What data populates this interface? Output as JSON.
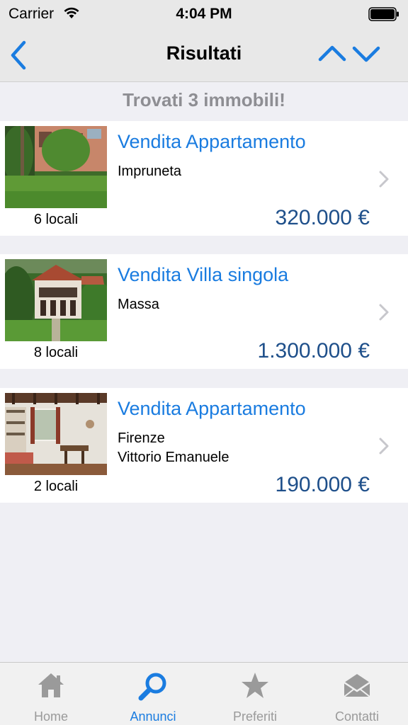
{
  "status_bar": {
    "carrier": "Carrier",
    "time": "4:04 PM"
  },
  "nav": {
    "title": "Risultati",
    "back_icon": "chevron-left-icon",
    "up_icon": "chevron-up-icon",
    "down_icon": "chevron-down-icon"
  },
  "results": {
    "count_text": "Trovati 3 immobili!"
  },
  "listings": [
    {
      "title": "Vendita Appartamento",
      "city": "Impruneta",
      "street": "",
      "rooms": "6 locali",
      "price": "320.000 €"
    },
    {
      "title": "Vendita Villa singola",
      "city": "Massa",
      "street": "",
      "rooms": "8 locali",
      "price": "1.300.000 €"
    },
    {
      "title": "Vendita Appartamento",
      "city": "Firenze",
      "street": "Vittorio Emanuele",
      "rooms": "2 locali",
      "price": "190.000 €"
    }
  ],
  "tabs": [
    {
      "label": "Home",
      "icon": "home-icon",
      "active": false
    },
    {
      "label": "Annunci",
      "icon": "search-icon",
      "active": true
    },
    {
      "label": "Preferiti",
      "icon": "star-icon",
      "active": false
    },
    {
      "label": "Contatti",
      "icon": "envelope-icon",
      "active": false
    }
  ],
  "colors": {
    "accent": "#1a7ce0",
    "price": "#1e4f8a",
    "muted": "#8e8e93",
    "background": "#efeff4"
  }
}
